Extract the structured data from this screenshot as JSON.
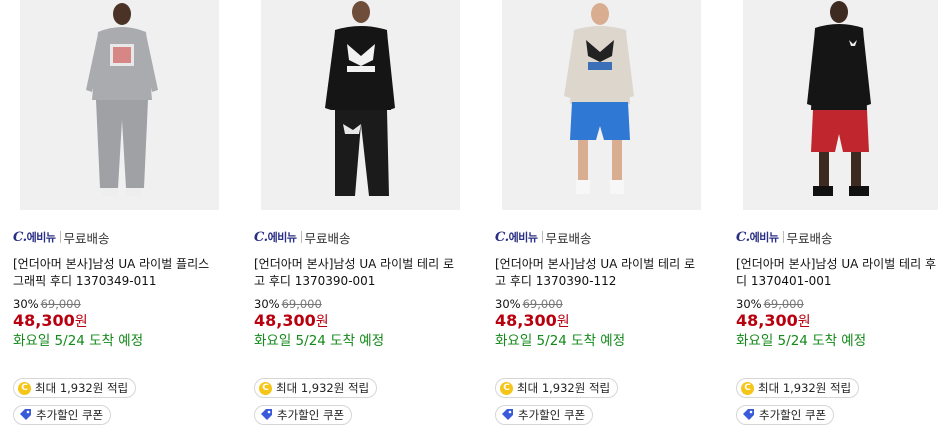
{
  "products": [
    {
      "seller_logo": "C.",
      "seller_logo_word": "에비뉴",
      "shipping": "무료배송",
      "title": "[언더아머 본사]남성 UA 라이벌 플리스 그래픽 후디 1370349-011",
      "discount": "30%",
      "original_price": "69,000",
      "price": "48,300",
      "currency": "원",
      "arrival": "화요일 5/24 도착 예정",
      "points": "최대 1,932원 적립",
      "coupon": "추가할인 쿠폰",
      "image": "model in grey hoodie and grey joggers"
    },
    {
      "seller_logo": "C.",
      "seller_logo_word": "에비뉴",
      "shipping": "무료배송",
      "title": "[언더아머 본사]남성 UA 라이벌 테리 로고 후디 1370390-001",
      "discount": "30%",
      "original_price": "69,000",
      "price": "48,300",
      "currency": "원",
      "arrival": "화요일 5/24 도착 예정",
      "points": "최대 1,932원 적립",
      "coupon": "추가할인 쿠폰",
      "image": "model in black hoodie and black pants"
    },
    {
      "seller_logo": "C.",
      "seller_logo_word": "에비뉴",
      "shipping": "무료배송",
      "title": "[언더아머 본사]남성 UA 라이벌 테리 로고 후디 1370390-112",
      "discount": "30%",
      "original_price": "69,000",
      "price": "48,300",
      "currency": "원",
      "arrival": "화요일 5/24 도착 예정",
      "points": "최대 1,932원 적립",
      "coupon": "추가할인 쿠폰",
      "image": "model in light heather hoodie and blue shorts"
    },
    {
      "seller_logo": "C.",
      "seller_logo_word": "에비뉴",
      "shipping": "무료배송",
      "title": "[언더아머 본사]남성 UA 라이벌 테리 후디 1370401-001",
      "discount": "30%",
      "original_price": "69,000",
      "price": "48,300",
      "currency": "원",
      "arrival": "화요일 5/24 도착 예정",
      "points": "최대 1,932원 적립",
      "coupon": "추가할인 쿠폰",
      "image": "model in black hoodie and red shorts"
    }
  ],
  "colors": {
    "price": "#b8000f",
    "arrival": "#138a1a",
    "seller_logo": "#2a2f86",
    "coin": "#f5c518",
    "coupon_icon": "#3a5bd9"
  },
  "icons": {
    "points": "coin-icon",
    "coupon": "coupon-tag-icon"
  }
}
